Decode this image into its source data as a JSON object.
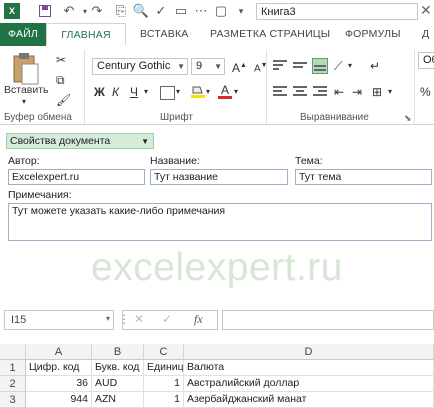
{
  "titlebar": {
    "logo": "X",
    "workbook_name": "Книга3",
    "close_glyph": "✕"
  },
  "tabs": [
    {
      "label": "ФАЙЛ"
    },
    {
      "label": "ГЛАВНАЯ"
    },
    {
      "label": "ВСТАВКА"
    },
    {
      "label": "РАЗМЕТКА СТРАНИЦЫ"
    },
    {
      "label": "ФОРМУЛЫ"
    },
    {
      "label": "Д"
    }
  ],
  "ribbon": {
    "paste_label": "Вставить",
    "font_name": "Century Gothic",
    "font_size": "9",
    "bold": "Ж",
    "italic": "К",
    "underline": "Ч",
    "number_format": "Об",
    "groups": {
      "clipboard": "Буфер обмена",
      "font": "Шрифт",
      "alignment": "Выравнивание"
    }
  },
  "doc_props": {
    "button_label": "Свойства документа",
    "author_label": "Автор:",
    "author_value": "Excelexpert.ru",
    "title_label": "Название:",
    "title_value": "Тут название",
    "subject_label": "Тема:",
    "subject_value": "Тут тема",
    "comments_label": "Примечания:",
    "comments_value": "Тут можете указать какие-либо примечания"
  },
  "watermark": "excelexpert.ru",
  "formula_bar": {
    "cell_ref": "I15",
    "fx": "fx",
    "formula": ""
  },
  "grid": {
    "columns": [
      "A",
      "B",
      "C",
      "D"
    ],
    "rows": [
      {
        "num": "1",
        "a": "Цифр. код",
        "b": "Букв. код",
        "c": "Единиц",
        "d": "Валюта"
      },
      {
        "num": "2",
        "a": "36",
        "b": "AUD",
        "c": "1",
        "d": "Австралийский доллар"
      },
      {
        "num": "3",
        "a": "944",
        "b": "AZN",
        "c": "1",
        "d": "Азербайджанский манат"
      }
    ]
  }
}
